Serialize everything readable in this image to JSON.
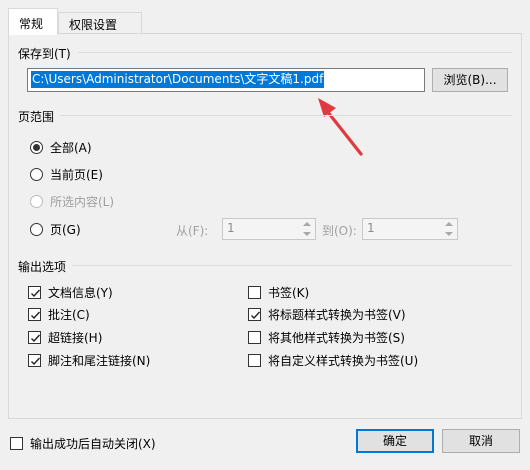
{
  "tabs": [
    {
      "label": "常规",
      "active": true
    },
    {
      "label": "权限设置",
      "active": false
    }
  ],
  "save_section": {
    "label": "保存到(T)",
    "path_value": "C:\\Users\\Administrator\\Documents\\文字文稿1.pdf",
    "browse_label": "浏览(B)..."
  },
  "page_range": {
    "label": "页范围",
    "options": [
      {
        "label": "全部(A)",
        "checked": true,
        "disabled": false
      },
      {
        "label": "当前页(E)",
        "checked": false,
        "disabled": false
      },
      {
        "label": "所选内容(L)",
        "checked": false,
        "disabled": true
      },
      {
        "label": "页(G)",
        "checked": false,
        "disabled": false
      }
    ],
    "from_label": "从(F):",
    "from_value": "1",
    "to_label": "到(O):",
    "to_value": "1"
  },
  "output_options": {
    "label": "输出选项",
    "left": [
      {
        "label": "文档信息(Y)",
        "checked": true
      },
      {
        "label": "批注(C)",
        "checked": true
      },
      {
        "label": "超链接(H)",
        "checked": true
      },
      {
        "label": "脚注和尾注链接(N)",
        "checked": true
      }
    ],
    "right": [
      {
        "label": "书签(K)",
        "checked": false
      },
      {
        "label": "将标题样式转换为书签(V)",
        "checked": true
      },
      {
        "label": "将其他样式转换为书签(S)",
        "checked": false
      },
      {
        "label": "将自定义样式转换为书签(U)",
        "checked": false
      }
    ]
  },
  "footer": {
    "auto_close_label": "输出成功后自动关闭(X)",
    "auto_close_checked": false,
    "ok_label": "确定",
    "cancel_label": "取消"
  },
  "colors": {
    "selection": "#0078d7",
    "annotation_arrow": "#e0393e"
  }
}
